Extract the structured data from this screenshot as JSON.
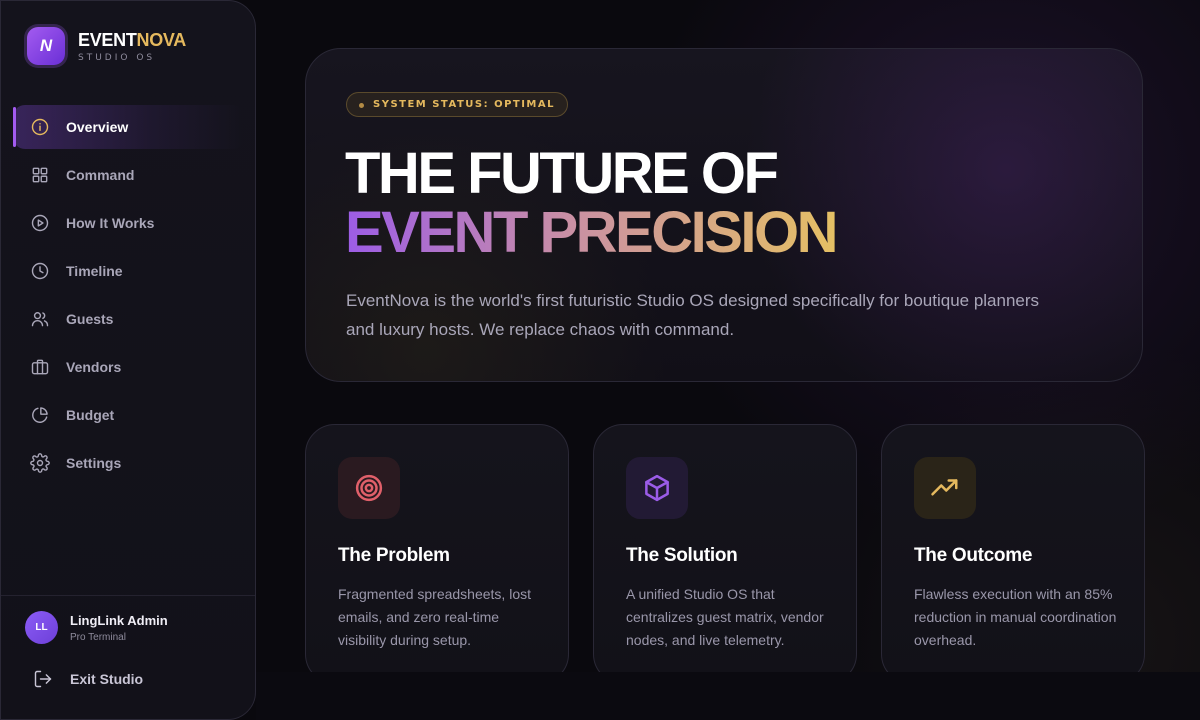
{
  "brand": {
    "logo_letter": "N",
    "name_part1": "EVENT",
    "name_part2": "NOVA",
    "subtitle": "STUDIO OS",
    "accent_gold": "#e5b95e",
    "accent_purple": "#a35bf0"
  },
  "sidebar": {
    "items": [
      {
        "label": "Overview",
        "icon": "info-circle-icon",
        "active": true
      },
      {
        "label": "Command",
        "icon": "grid-icon",
        "active": false
      },
      {
        "label": "How It Works",
        "icon": "play-circle-icon",
        "active": false
      },
      {
        "label": "Timeline",
        "icon": "clock-icon",
        "active": false
      },
      {
        "label": "Guests",
        "icon": "users-icon",
        "active": false
      },
      {
        "label": "Vendors",
        "icon": "briefcase-icon",
        "active": false
      },
      {
        "label": "Budget",
        "icon": "pie-chart-icon",
        "active": false
      },
      {
        "label": "Settings",
        "icon": "gear-icon",
        "active": false
      }
    ]
  },
  "user": {
    "initials": "LL",
    "name": "LingLink Admin",
    "role": "Pro Terminal"
  },
  "exit": {
    "label": "Exit Studio",
    "icon": "logout-icon"
  },
  "hero": {
    "status": "SYSTEM STATUS: OPTIMAL",
    "title_line1": "THE FUTURE OF",
    "title_line2": "EVENT PRECISION",
    "description": "EventNova is the world's first futuristic Studio OS designed specifically for boutique planners and luxury hosts. We replace chaos with command."
  },
  "cards": [
    {
      "title": "The Problem",
      "text": "Fragmented spreadsheets, lost emails, and zero real-time visibility during setup.",
      "icon": "target-icon",
      "color": "#e0606a"
    },
    {
      "title": "The Solution",
      "text": "A unified Studio OS that centralizes guest matrix, vendor nodes, and live telemetry.",
      "icon": "cube-icon",
      "color": "#9b5ce8"
    },
    {
      "title": "The Outcome",
      "text": "Flawless execution with an 85% reduction in manual coordination overhead.",
      "icon": "trending-up-icon",
      "color": "#e5b95e"
    }
  ]
}
